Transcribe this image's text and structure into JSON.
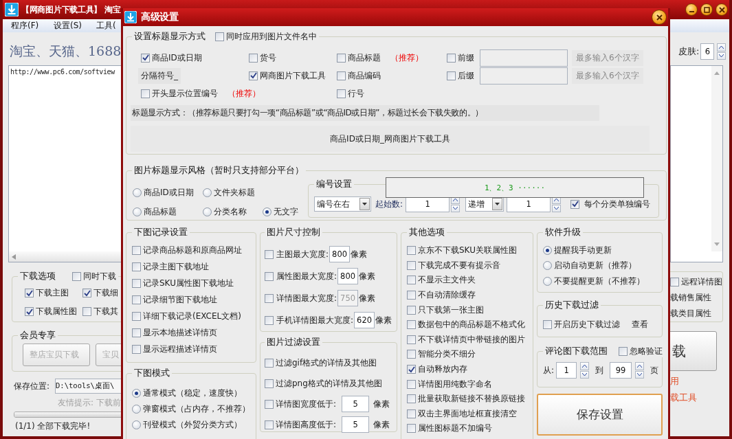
{
  "main_window": {
    "title": "【网商图片下载工具】 淘宝",
    "menu": [
      "程序(F)",
      "设置(S)",
      "工具("
    ],
    "headline": "淘宝、天猫、1688",
    "url_field": {
      "value": "http://www.pc6.com/softview"
    },
    "download_options": {
      "legend": "下载选项",
      "together": {
        "label": "同时下载",
        "checked": false
      },
      "items": [
        {
          "label": "下载主图",
          "checked": true
        },
        {
          "label": "下载细",
          "checked": true
        },
        {
          "label": "下载属性图",
          "checked": true
        },
        {
          "label": "下载其",
          "checked": false
        }
      ]
    },
    "member": {
      "legend": "会员专享",
      "buttons": [
        "整店宝贝下载",
        "宝贝"
      ]
    },
    "save_location": {
      "label": "保存位置:",
      "value": "D:\\tools\\桌面\\"
    },
    "tip": "友情提示: 下载前",
    "progress": {
      "level": 1
    },
    "status": "(1/1) 全部下载完毕!",
    "skin": {
      "label": "皮肤:",
      "value": "6"
    },
    "right_options": {
      "remote": {
        "label": "远程详情图",
        "checked": false
      },
      "texts": [
        "载销售属性",
        "载类目属性"
      ]
    },
    "download_button": "载",
    "notes": [
      "用",
      "载工具"
    ]
  },
  "dialog": {
    "title": "高级设置",
    "title_section": {
      "legend": "设置标题显示方式",
      "apply_to_filename": {
        "label": "同时应用到图片文件名中",
        "checked": false
      },
      "columns": [
        [
          {
            "kind": "checkbox",
            "label": "商品ID或日期",
            "checked": true
          },
          {
            "kind": "separator",
            "label": "分隔符号_"
          },
          {
            "kind": "checkbox",
            "label": "开头显示位置编号",
            "checked": false,
            "note": "（推荐）"
          }
        ],
        [
          {
            "kind": "checkbox",
            "label": "货号",
            "checked": false
          },
          {
            "kind": "checkbox",
            "label": "网商图片下载工具",
            "checked": true
          }
        ],
        [
          {
            "kind": "checkbox",
            "label": "商品标题",
            "checked": false,
            "note": "（推荐）"
          },
          {
            "kind": "checkbox",
            "label": "商品编码",
            "checked": false
          },
          {
            "kind": "checkbox",
            "label": "行号",
            "checked": false
          }
        ]
      ],
      "affixes": [
        {
          "label": "前缀",
          "checked": false,
          "hint": "最多输入6个汉字"
        },
        {
          "label": "后缀",
          "checked": false,
          "hint": "最多输入6个汉字"
        }
      ],
      "rule": "标题显示方式：（推荐标题只要打勾一项“商品标题”或“商品ID或日期”，标题过长会下载失败的。）",
      "preview": "商品ID或日期_网商图片下载工具"
    },
    "style_section": {
      "legend": "图片标题显示风格（暂时只支持部分平台）",
      "radio_rows": [
        [
          {
            "label": "商品ID或日期",
            "selected": false
          },
          {
            "label": "文件夹标题",
            "selected": false
          }
        ],
        [
          {
            "label": "商品标题",
            "selected": false
          },
          {
            "label": "分类名称",
            "selected": false
          },
          {
            "label": "无文字",
            "selected": true
          }
        ]
      ],
      "numbering": {
        "legend": "编号设置",
        "position_select": "编号在右",
        "start_label": "起始数:",
        "start_value": "1",
        "order_select": "递增",
        "step_value": "1",
        "per_category": {
          "label": "每个分类单独编号",
          "checked": true
        }
      },
      "sample": "1、2、3 ······"
    },
    "record_section": {
      "legend": "下图记录设置",
      "items": [
        {
          "label": "记录商品标题和原商品网址",
          "checked": false
        },
        {
          "label": "记录主图下载地址",
          "checked": false
        },
        {
          "label": "记录SKU属性图下载地址",
          "checked": false
        },
        {
          "label": "记录细节图下载地址",
          "checked": false
        },
        {
          "label": "详细下载记录(EXCEL文档)",
          "checked": false
        },
        {
          "label": "显示本地描述详情页",
          "checked": false
        },
        {
          "label": "显示远程描述详情页",
          "checked": false
        }
      ]
    },
    "mode_section": {
      "legend": "下图模式",
      "options": [
        {
          "label": "通常模式（稳定，速度快）",
          "selected": true
        },
        {
          "label": "弹窗模式（占内存，不推荐）",
          "selected": false
        },
        {
          "label": "刊登模式（外贸分类方式）",
          "selected": false
        }
      ]
    },
    "size_section": {
      "legend": "图片尺寸控制",
      "items": [
        {
          "label": "主图最大宽度:",
          "checked": false,
          "value": "800",
          "unit": "像素",
          "disabled": false
        },
        {
          "label": "属性图最大宽度:",
          "checked": false,
          "value": "800",
          "unit": "像素",
          "disabled": false
        },
        {
          "label": "详情图最大宽度:",
          "checked": false,
          "value": "750",
          "unit": "像素",
          "disabled": true
        },
        {
          "label": "手机详情图最大宽度:",
          "checked": false,
          "value": "620",
          "unit": "像素",
          "disabled": false
        }
      ]
    },
    "filter_section": {
      "legend": "图片过滤设置",
      "items": [
        {
          "kind": "checkbox",
          "label": "过滤gif格式的详情及其他图",
          "checked": false
        },
        {
          "kind": "checkbox",
          "label": "过滤png格式的详情及其他图",
          "checked": false
        },
        {
          "kind": "threshold",
          "label": "详情图宽度低于:",
          "checked": false,
          "value": "5",
          "unit": "像素"
        },
        {
          "kind": "threshold",
          "label": "详情图高度低于:",
          "checked": false,
          "value": "5",
          "unit": "像素"
        }
      ]
    },
    "other_section": {
      "legend": "其他选项",
      "items": [
        {
          "label": "京东不下载SKU关联属性图",
          "checked": false
        },
        {
          "label": "下载完成不要有提示音",
          "checked": false
        },
        {
          "label": "不显示主文件夹",
          "checked": false
        },
        {
          "label": "不自动清除缓存",
          "checked": false
        },
        {
          "label": "只下载第一张主图",
          "checked": false
        },
        {
          "label": "数据包中的商品标题不格式化",
          "checked": false
        },
        {
          "label": "不下载详情页中带链接的图片",
          "checked": false
        },
        {
          "label": "智能分类不细分",
          "checked": false
        },
        {
          "label": "自动释放内存",
          "checked": true
        },
        {
          "label": "详情图用纯数字命名",
          "checked": false
        },
        {
          "label": "批量获取新链接不替换原链接",
          "checked": false
        },
        {
          "label": "双击主界面地址框直接清空",
          "checked": false
        },
        {
          "label": "属性图标题不加编号",
          "checked": false
        }
      ]
    },
    "upgrade_section": {
      "legend": "软件升级",
      "options": [
        {
          "label": "提醒我手动更新",
          "selected": true
        },
        {
          "label": "启动自动更新（推荐）",
          "selected": false
        },
        {
          "label": "不要提醒更新（不推荐）",
          "selected": false
        }
      ]
    },
    "history_section": {
      "legend": "历史下载过滤",
      "checkbox": {
        "label": "开启历史下载过滤",
        "checked": false
      },
      "link": "查看"
    },
    "review_section": {
      "legend": "评论图下载范围",
      "ignore": {
        "label": "忽略验证",
        "checked": false
      },
      "from_label": "从:",
      "from_value": "1",
      "to_label": "到",
      "to_value": "99",
      "unit": "页"
    },
    "save_button": "保存设置"
  }
}
